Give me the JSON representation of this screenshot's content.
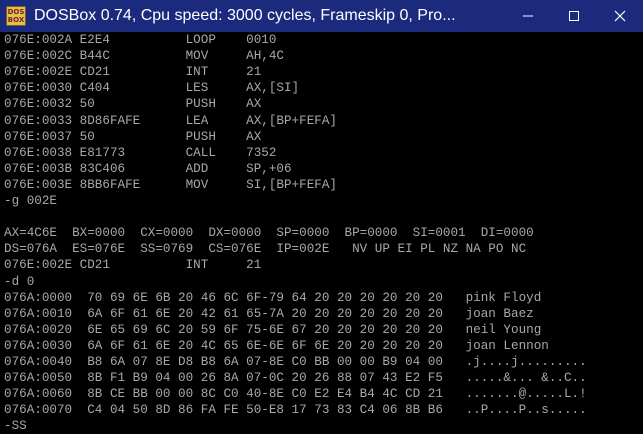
{
  "window": {
    "icon_top": "DOS",
    "icon_bottom": "BOX",
    "title": "DOSBox 0.74, Cpu speed:     3000 cycles, Frameskip  0, Pro..."
  },
  "terminal": {
    "text_color": "#a8a8a8",
    "lines": [
      "076E:002A E2E4          LOOP    0010",
      "076E:002C B44C          MOV     AH,4C",
      "076E:002E CD21          INT     21",
      "076E:0030 C404          LES     AX,[SI]",
      "076E:0032 50            PUSH    AX",
      "076E:0033 8D86FAFE      LEA     AX,[BP+FEFA]",
      "076E:0037 50            PUSH    AX",
      "076E:0038 E81773        CALL    7352",
      "076E:003B 83C406        ADD     SP,+06",
      "076E:003E 8BB6FAFE      MOV     SI,[BP+FEFA]",
      "-g 002E",
      "",
      "AX=4C6E  BX=0000  CX=0000  DX=0000  SP=0000  BP=0000  SI=0001  DI=0000",
      "DS=076A  ES=076E  SS=0769  CS=076E  IP=002E   NV UP EI PL NZ NA PO NC",
      "076E:002E CD21          INT     21",
      "-d 0",
      "076A:0000  70 69 6E 6B 20 46 6C 6F-79 64 20 20 20 20 20 20   pink Floyd",
      "076A:0010  6A 6F 61 6E 20 42 61 65-7A 20 20 20 20 20 20 20   joan Baez",
      "076A:0020  6E 65 69 6C 20 59 6F 75-6E 67 20 20 20 20 20 20   neil Young",
      "076A:0030  6A 6F 61 6E 20 4C 65 6E-6E 6F 6E 20 20 20 20 20   joan Lennon",
      "076A:0040  B8 6A 07 8E D8 B8 6A 07-8E C0 BB 00 00 B9 04 00   .j....j.........",
      "076A:0050  8B F1 B9 04 00 26 8A 07-0C 20 26 88 07 43 E2 F5   .....&... &..C..",
      "076A:0060  8B CE BB 00 00 8C C0 40-8E C0 E2 E4 B4 4C CD 21   .......@.....L.!",
      "076A:0070  C4 04 50 8D 86 FA FE 50-E8 17 73 83 C4 06 8B B6   ..P....P..s.....",
      "-SS"
    ]
  }
}
